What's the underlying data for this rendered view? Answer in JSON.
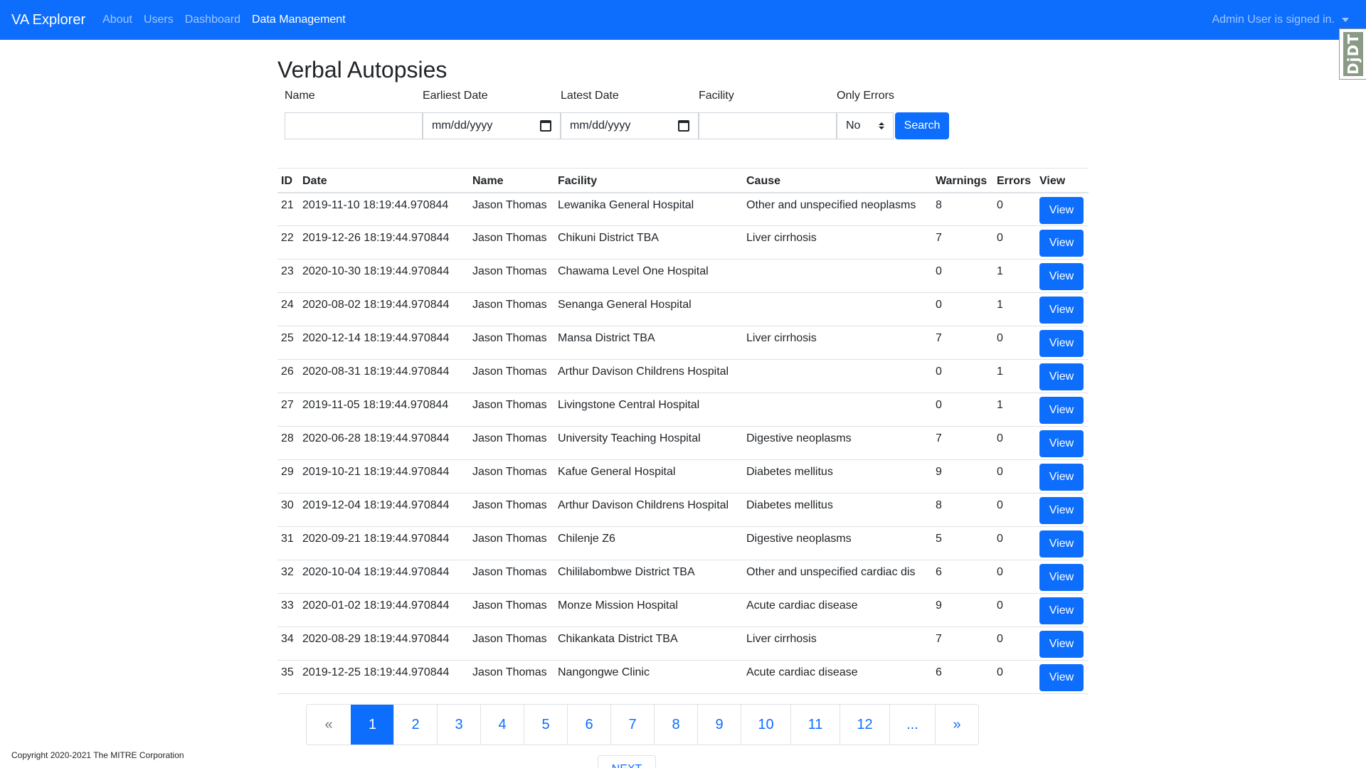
{
  "navbar": {
    "brand": "VA Explorer",
    "links": [
      "About",
      "Users",
      "Dashboard",
      "Data Management"
    ],
    "active_link": "Data Management",
    "user_menu": "Admin User is signed in.",
    "accent_color": "#0d6efd"
  },
  "debug_toolbar": {
    "label": "DjDT"
  },
  "page": {
    "title": "Verbal Autopsies"
  },
  "filters": {
    "name_label": "Name",
    "earliest_label": "Earliest Date",
    "earliest_value": "mm/dd/yyyy",
    "latest_label": "Latest Date",
    "latest_value": "mm/dd/yyyy",
    "facility_label": "Facility",
    "only_errors_label": "Only Errors",
    "only_errors_value": "No",
    "search_label": "Search"
  },
  "table": {
    "headers": [
      "ID",
      "Date",
      "Name",
      "Facility",
      "Cause",
      "Warnings",
      "Errors",
      "View"
    ],
    "view_label": "View",
    "rows": [
      {
        "id": "21",
        "date": "2019-11-10 18:19:44.970844",
        "name": "Jason Thomas",
        "facility": "Lewanika General Hospital",
        "cause": "Other and unspecified neoplasms",
        "warnings": "8",
        "errors": "0"
      },
      {
        "id": "22",
        "date": "2019-12-26 18:19:44.970844",
        "name": "Jason Thomas",
        "facility": "Chikuni District TBA",
        "cause": "Liver cirrhosis",
        "warnings": "7",
        "errors": "0"
      },
      {
        "id": "23",
        "date": "2020-10-30 18:19:44.970844",
        "name": "Jason Thomas",
        "facility": "Chawama Level One Hospital",
        "cause": "",
        "warnings": "0",
        "errors": "1"
      },
      {
        "id": "24",
        "date": "2020-08-02 18:19:44.970844",
        "name": "Jason Thomas",
        "facility": "Senanga General Hospital",
        "cause": "",
        "warnings": "0",
        "errors": "1"
      },
      {
        "id": "25",
        "date": "2020-12-14 18:19:44.970844",
        "name": "Jason Thomas",
        "facility": "Mansa District TBA",
        "cause": "Liver cirrhosis",
        "warnings": "7",
        "errors": "0"
      },
      {
        "id": "26",
        "date": "2020-08-31 18:19:44.970844",
        "name": "Jason Thomas",
        "facility": "Arthur Davison Childrens Hospital",
        "cause": "",
        "warnings": "0",
        "errors": "1"
      },
      {
        "id": "27",
        "date": "2019-11-05 18:19:44.970844",
        "name": "Jason Thomas",
        "facility": "Livingstone Central Hospital",
        "cause": "",
        "warnings": "0",
        "errors": "1"
      },
      {
        "id": "28",
        "date": "2020-06-28 18:19:44.970844",
        "name": "Jason Thomas",
        "facility": "University Teaching Hospital",
        "cause": "Digestive neoplasms",
        "warnings": "7",
        "errors": "0"
      },
      {
        "id": "29",
        "date": "2019-10-21 18:19:44.970844",
        "name": "Jason Thomas",
        "facility": "Kafue General Hospital",
        "cause": "Diabetes mellitus",
        "warnings": "9",
        "errors": "0"
      },
      {
        "id": "30",
        "date": "2019-12-04 18:19:44.970844",
        "name": "Jason Thomas",
        "facility": "Arthur Davison Childrens Hospital",
        "cause": "Diabetes mellitus",
        "warnings": "8",
        "errors": "0"
      },
      {
        "id": "31",
        "date": "2020-09-21 18:19:44.970844",
        "name": "Jason Thomas",
        "facility": "Chilenje Z6",
        "cause": "Digestive neoplasms",
        "warnings": "5",
        "errors": "0"
      },
      {
        "id": "32",
        "date": "2020-10-04 18:19:44.970844",
        "name": "Jason Thomas",
        "facility": "Chililabombwe District TBA",
        "cause": "Other and unspecified cardiac dis",
        "warnings": "6",
        "errors": "0"
      },
      {
        "id": "33",
        "date": "2020-01-02 18:19:44.970844",
        "name": "Jason Thomas",
        "facility": "Monze Mission Hospital",
        "cause": "Acute cardiac disease",
        "warnings": "9",
        "errors": "0"
      },
      {
        "id": "34",
        "date": "2020-08-29 18:19:44.970844",
        "name": "Jason Thomas",
        "facility": "Chikankata District TBA",
        "cause": "Liver cirrhosis",
        "warnings": "7",
        "errors": "0"
      },
      {
        "id": "35",
        "date": "2019-12-25 18:19:44.970844",
        "name": "Jason Thomas",
        "facility": "Nangongwe Clinic",
        "cause": "Acute cardiac disease",
        "warnings": "6",
        "errors": "0"
      }
    ]
  },
  "pagination": {
    "items": [
      "«",
      "1",
      "2",
      "3",
      "4",
      "5",
      "6",
      "7",
      "8",
      "9",
      "10",
      "11",
      "12",
      "...",
      "»"
    ],
    "active": "1",
    "next_label": "NEXT"
  },
  "footer": {
    "copyright": "Copyright 2020-2021 The MITRE Corporation"
  }
}
